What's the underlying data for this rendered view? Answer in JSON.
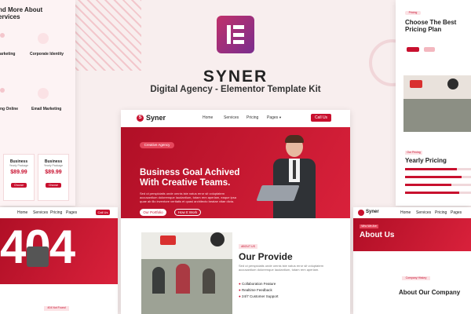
{
  "brand": {
    "name": "SYNER",
    "subtitle": "Digital Agency - Elementor Template Kit"
  },
  "left_top": {
    "heading_line1": "nd More About",
    "heading_line2": "ervices",
    "items": [
      "arketing",
      "Corporate Identity",
      "ng Online",
      "Email Marketing"
    ],
    "cards": [
      {
        "name": "Business",
        "sub": "Yearly Package",
        "price": "$89.99",
        "button": "Choose"
      },
      {
        "name": "Business",
        "sub": "Yearly Package",
        "price": "$89.99",
        "button": "Choose"
      }
    ]
  },
  "right_top": {
    "tag": "Pricing",
    "heading_line1": "Choose The Best",
    "heading_line2": "Pricing Plan",
    "tag2": "Our Pricing",
    "heading2": "Yearly Pricing"
  },
  "main": {
    "logo_text": "Syner",
    "nav": [
      "Home",
      "Services",
      "Pricing",
      "Pages"
    ],
    "call_button": "Call Us",
    "badge": "Creative Agency",
    "title_line1": "Business Goal Achived",
    "title_line2": "With Creative Teams.",
    "text": "Sed ut perspiciatis unde omnis iste natus error sit voluptatem accusantium doloremque laudantium, totam rem aperiam, eaque ipsa quae ab illo inventore veritatis et quasi architecto beatae vitae dicta.",
    "btn_primary": "Our Portfolio",
    "btn_secondary": "How It Work",
    "provide_tag": "ABOUT US",
    "provide_title": "Our Provide",
    "provide_text": "Sed ut perspiciatis unde omnis iste natus error sit voluptatem accusantium doloremque laudantium, totam rem aperiam.",
    "provide_list": [
      "Collaboration Feature",
      "Realtime Feedback",
      "24/7 Customer Support"
    ]
  },
  "left_bottom": {
    "nav": [
      "Home",
      "Services",
      "Pricing",
      "Pages"
    ],
    "call_button": "Call Us",
    "error_code": "404",
    "footer_tag": "404 Not Found"
  },
  "right_bottom": {
    "logo_text": "Syner",
    "nav": [
      "Home",
      "Services",
      "Pricing",
      "Pages"
    ],
    "call_button": "Call Us",
    "tag": "Who We Are",
    "title": "About Us",
    "tag2": "Company History",
    "title2": "About Our Company"
  },
  "colors": {
    "primary": "#c8102e",
    "background": "#f8eeee",
    "logo_gradient_start": "#c0306a",
    "logo_gradient_end": "#7a2e8e"
  }
}
